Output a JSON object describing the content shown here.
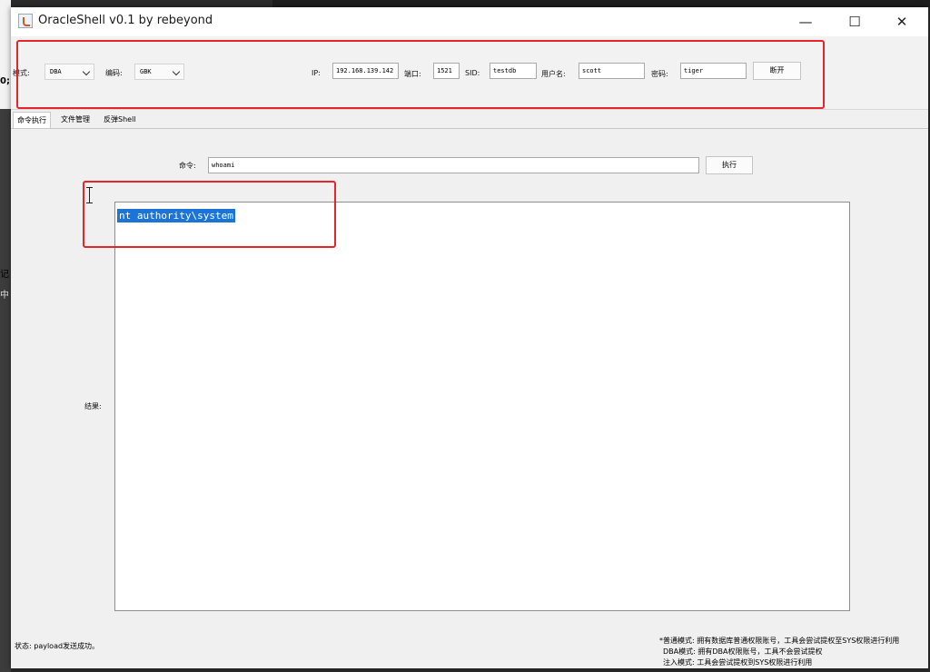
{
  "window": {
    "title": "OracleShell v0.1  by rebeyond",
    "minimize": "—",
    "maximize": "☐",
    "close": "✕"
  },
  "connection": {
    "mode_label": "模式:",
    "mode_value": "DBA",
    "encoding_label": "编码:",
    "encoding_value": "GBK",
    "ip_label": "IP:",
    "ip_value": "192.168.139.142",
    "port_label": "端口:",
    "port_value": "1521",
    "sid_label": "SID:",
    "sid_value": "testdb",
    "username_label": "用户名:",
    "username_value": "scott",
    "password_label": "密码:",
    "password_value": "tiger",
    "disconnect_label": "断开"
  },
  "tabs": [
    {
      "label": "命令执行",
      "active": true
    },
    {
      "label": "文件管理",
      "active": false
    },
    {
      "label": "反弹Shell",
      "active": false
    }
  ],
  "command": {
    "label": "命令:",
    "value": "whoami",
    "execute_label": "执行"
  },
  "result": {
    "label": "结果:",
    "output_text": "nt authority\\system"
  },
  "status": {
    "text": "状态: payload发送成功。"
  },
  "help_lines": [
    "*普通模式: 拥有数据库普通权限账号，工具会尝试提权至SYS权限进行利用",
    "DBA模式: 拥有DBA权限账号，工具不会尝试提权",
    "注入模式: 工具会尝试提权到SYS权限进行利用"
  ],
  "background": {
    "glyph1": "0;",
    "glyph2": "记",
    "glyph3": "中"
  },
  "colors": {
    "highlight": "#e3262b",
    "selection": "#1b74d8"
  }
}
